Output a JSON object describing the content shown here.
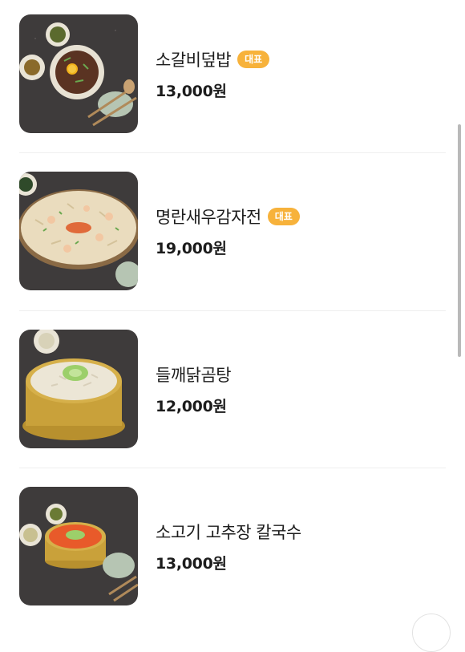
{
  "menu": {
    "items": [
      {
        "name": "소갈비덮밥",
        "badge": "대표",
        "price": "13,000원",
        "image": "beef-rib-rice-bowl-photo"
      },
      {
        "name": "명란새우감자전",
        "badge": "대표",
        "price": "19,000원",
        "image": "pollack-roe-shrimp-potato-pancake-photo"
      },
      {
        "name": "들깨닭곰탕",
        "price": "12,000원",
        "image": "perilla-chicken-soup-photo"
      },
      {
        "name": "소고기 고추장 칼국수",
        "price": "13,000원",
        "image": "beef-gochujang-kalguksu-photo"
      }
    ]
  },
  "colors": {
    "badge_bg": "#f7b23b",
    "divider": "#efefef",
    "scrollbar": "#b9b9b9"
  }
}
